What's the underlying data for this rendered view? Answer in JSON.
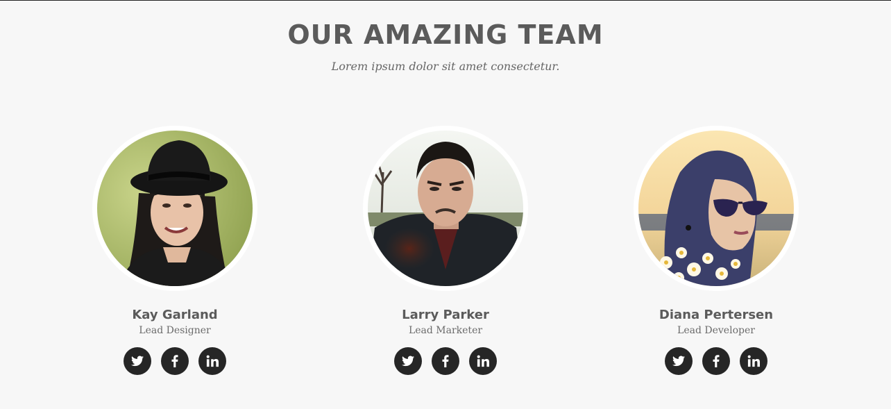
{
  "section": {
    "title": "OUR AMAZING TEAM",
    "subtitle": "Lorem ipsum dolor sit amet consectetur."
  },
  "team": [
    {
      "name": "Kay Garland",
      "role": "Lead Designer",
      "socials": [
        "twitter-icon",
        "facebook-icon",
        "linkedin-icon"
      ]
    },
    {
      "name": "Larry Parker",
      "role": "Lead Marketer",
      "socials": [
        "twitter-icon",
        "facebook-icon",
        "linkedin-icon"
      ]
    },
    {
      "name": "Diana Pertersen",
      "role": "Lead Developer",
      "socials": [
        "twitter-icon",
        "facebook-icon",
        "linkedin-icon"
      ]
    }
  ],
  "colors": {
    "background": "#f7f7f7",
    "heading": "#5b5b5b",
    "social_button": "#262626"
  }
}
